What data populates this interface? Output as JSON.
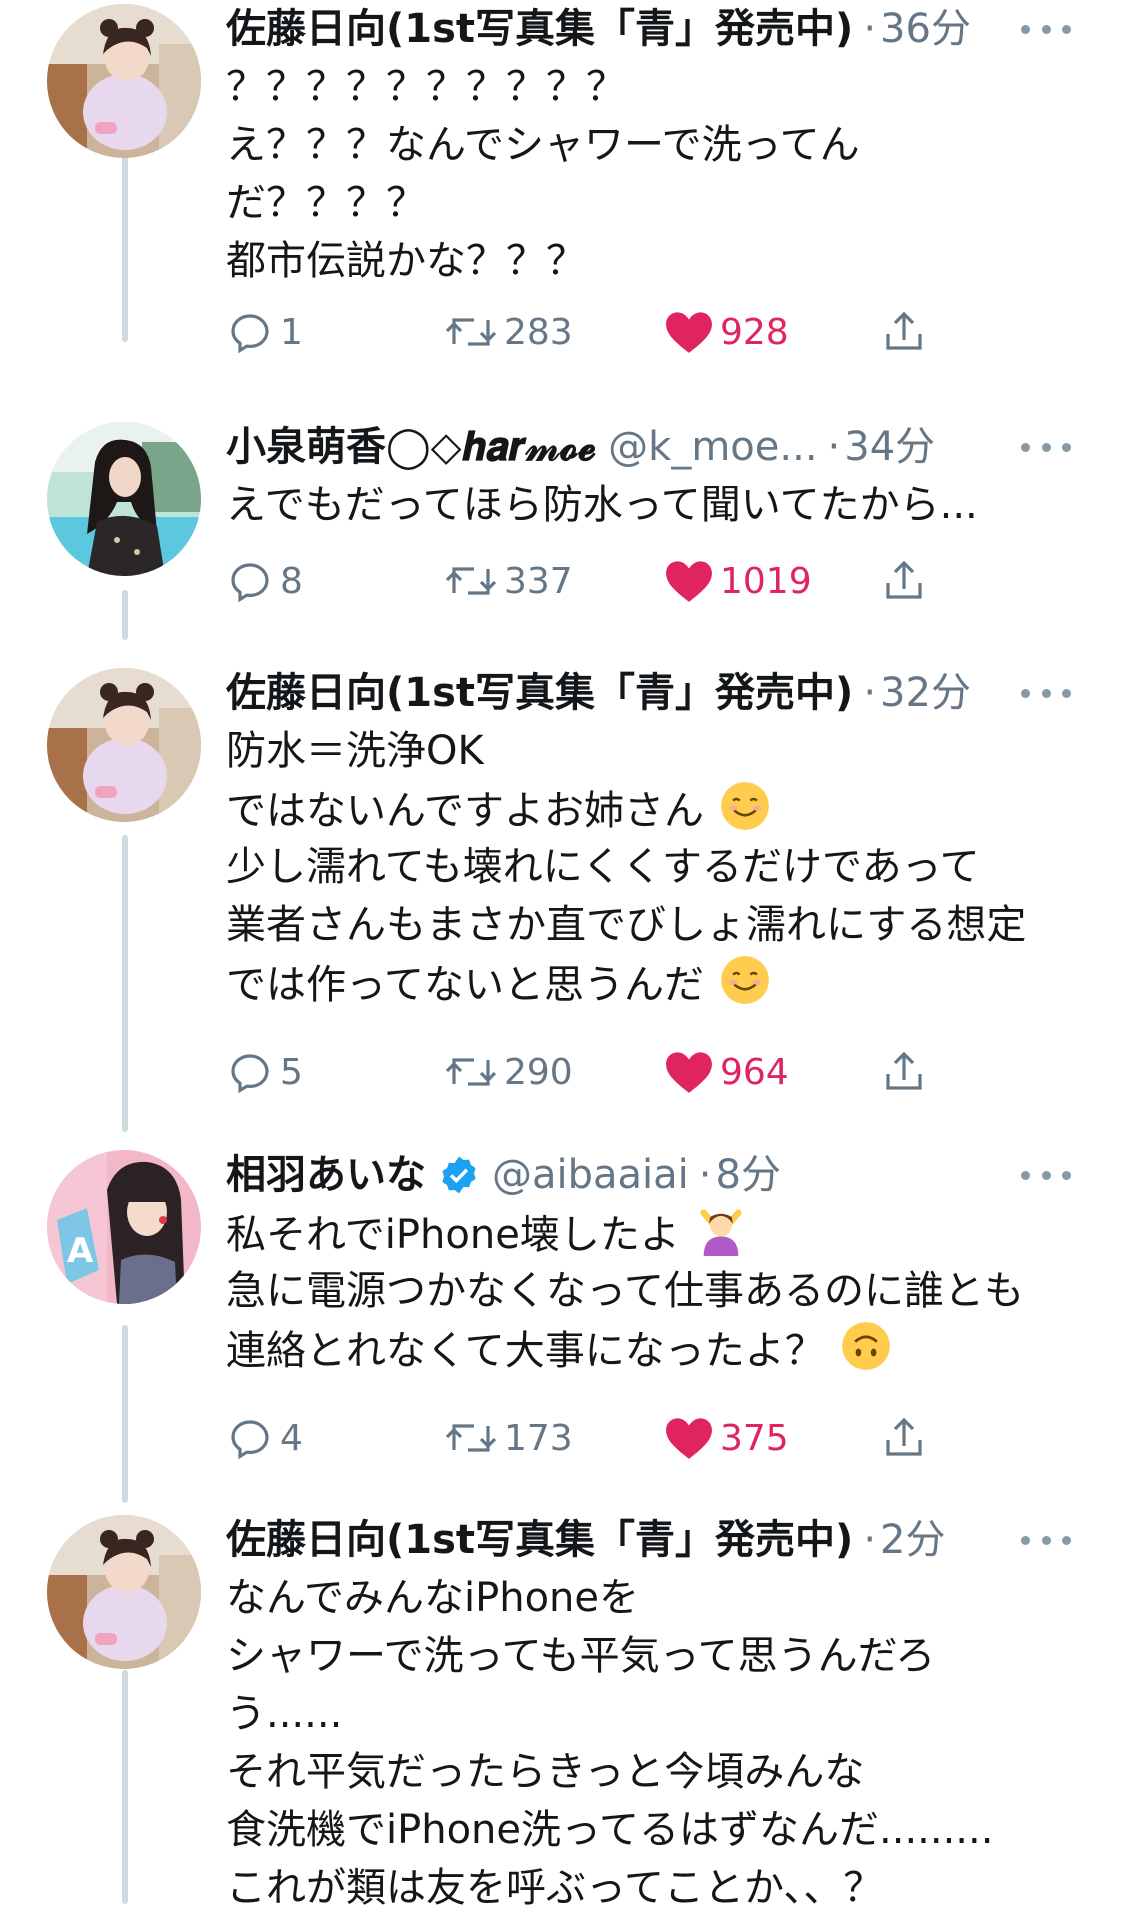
{
  "tweets": [
    {
      "name": "佐藤日向(1st写真集「青」発売中)",
      "handle": "",
      "verified": false,
      "time": "36分",
      "lines": [
        "？？？？？？？？？？",
        "え？？？なんでシャワーで洗ってん",
        "だ？？？？",
        "都市伝説かな？？？"
      ],
      "replies": "1",
      "retweets": "283",
      "likes": "928",
      "avatar": "hinata"
    },
    {
      "name": "小泉萌香◯◇𝒉𝒂𝒓𝓂𝓸𝓮",
      "handle": "@k_moe...",
      "verified": false,
      "time": "34分",
      "lines": [
        "えでもだってほら防水って聞いてたから..."
      ],
      "replies": "8",
      "retweets": "337",
      "likes": "1019",
      "avatar": "moeka"
    },
    {
      "name": "佐藤日向(1st写真集「青」発売中)",
      "handle": "",
      "verified": false,
      "time": "32分",
      "lines": [
        "防水＝洗浄OK",
        "ではないんですよお姉さん",
        "少し濡れても壊れにくくするだけであって",
        "業者さんもまさか直でびしょ濡れにする想定",
        "では作ってないと思うんだ"
      ],
      "emoji_lines": {
        "1": "smiling-face-emoji",
        "4": "smiling-face-emoji"
      },
      "replies": "5",
      "retweets": "290",
      "likes": "964",
      "avatar": "hinata"
    },
    {
      "name": "相羽あいな",
      "handle": "@aibaaiai",
      "verified": true,
      "time": "8分",
      "lines": [
        "私それでiPhone壊したよ",
        "急に電源つかなくなって仕事あるのに誰とも",
        "連絡とれなくて大事になったよ？"
      ],
      "emoji_lines": {
        "0": "person-gesturing-no-emoji",
        "2": "upside-down-face-emoji"
      },
      "replies": "4",
      "retweets": "173",
      "likes": "375",
      "avatar": "aina"
    },
    {
      "name": "佐藤日向(1st写真集「青」発売中)",
      "handle": "",
      "verified": false,
      "time": "2分",
      "lines": [
        "なんでみんなiPhoneを",
        "シャワーで洗っても平気って思うんだろ",
        "う......",
        "それ平気だったらきっと今頃みんな",
        "食洗機でiPhone洗ってるはずなんだ.........",
        "これが類は友を呼ぶってことか、、？"
      ],
      "avatar": "hinata"
    }
  ],
  "colors": {
    "text": "#14171a",
    "secondary": "#657786",
    "like": "#e0245e",
    "verified": "#1da1f2",
    "thread_line": "#cfd9de"
  },
  "icons": [
    "reply-icon",
    "retweet-icon",
    "like-icon",
    "share-icon",
    "more-icon",
    "verified-badge-icon"
  ]
}
